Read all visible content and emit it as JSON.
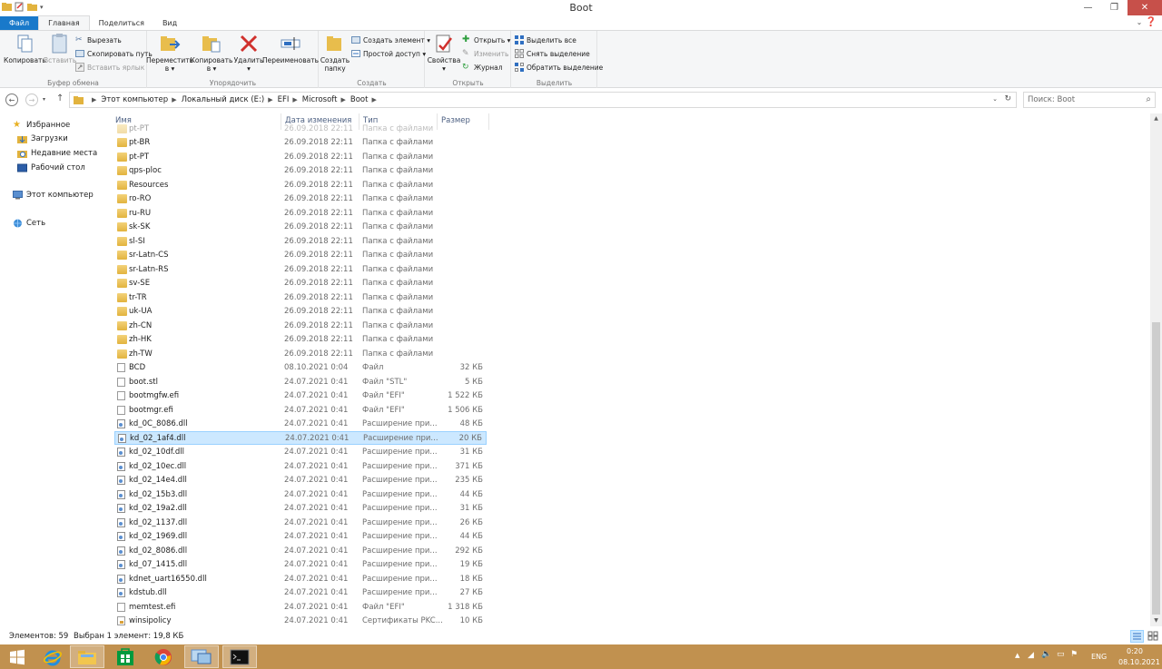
{
  "window": {
    "title": "Boot"
  },
  "tabs": [
    {
      "label": "Файл"
    },
    {
      "label": "Главная"
    },
    {
      "label": "Поделиться"
    },
    {
      "label": "Вид"
    }
  ],
  "ribbon": {
    "clipboard": {
      "label": "Буфер обмена",
      "copy": "Копировать",
      "paste": "Вставить",
      "cut": "Вырезать",
      "copy_path": "Скопировать путь",
      "paste_shortcut": "Вставить ярлык"
    },
    "organize": {
      "label": "Упорядочить",
      "move_to": "Переместить в ▾",
      "copy_to": "Копировать в ▾",
      "delete": "Удалить ▾",
      "rename": "Переименовать"
    },
    "create": {
      "label": "Создать",
      "new_folder": "Создать папку",
      "new_item": "Создать элемент ▾",
      "easy_access": "Простой доступ ▾"
    },
    "open": {
      "label": "Открыть",
      "properties": "Свойства ▾",
      "open": "Открыть ▾",
      "edit": "Изменить",
      "history": "Журнал"
    },
    "select": {
      "label": "Выделить",
      "select_all": "Выделить все",
      "select_none": "Снять выделение",
      "invert": "Обратить выделение"
    }
  },
  "address": {
    "segments": [
      "Этот компьютер",
      "Локальный диск (E:)",
      "EFI",
      "Microsoft",
      "Boot"
    ],
    "search_placeholder": "Поиск: Boot"
  },
  "navpane": {
    "favorites": "Избранное",
    "downloads": "Загрузки",
    "recent": "Недавние места",
    "desktop": "Рабочий стол",
    "this_pc": "Этот компьютер",
    "network": "Сеть"
  },
  "columns": {
    "name": "Имя",
    "date": "Дата изменения",
    "type": "Тип",
    "size": "Размер"
  },
  "files": [
    {
      "name": "pt-PT",
      "date": "26.09.2018 22:11",
      "type": "Папка с файлами",
      "size": "",
      "kind": "folder",
      "partial": true
    },
    {
      "name": "pt-BR",
      "date": "26.09.2018 22:11",
      "type": "Папка с файлами",
      "size": "",
      "kind": "folder"
    },
    {
      "name": "pt-PT",
      "date": "26.09.2018 22:11",
      "type": "Папка с файлами",
      "size": "",
      "kind": "folder"
    },
    {
      "name": "qps-ploc",
      "date": "26.09.2018 22:11",
      "type": "Папка с файлами",
      "size": "",
      "kind": "folder"
    },
    {
      "name": "Resources",
      "date": "26.09.2018 22:11",
      "type": "Папка с файлами",
      "size": "",
      "kind": "folder"
    },
    {
      "name": "ro-RO",
      "date": "26.09.2018 22:11",
      "type": "Папка с файлами",
      "size": "",
      "kind": "folder"
    },
    {
      "name": "ru-RU",
      "date": "26.09.2018 22:11",
      "type": "Папка с файлами",
      "size": "",
      "kind": "folder"
    },
    {
      "name": "sk-SK",
      "date": "26.09.2018 22:11",
      "type": "Папка с файлами",
      "size": "",
      "kind": "folder"
    },
    {
      "name": "sl-SI",
      "date": "26.09.2018 22:11",
      "type": "Папка с файлами",
      "size": "",
      "kind": "folder"
    },
    {
      "name": "sr-Latn-CS",
      "date": "26.09.2018 22:11",
      "type": "Папка с файлами",
      "size": "",
      "kind": "folder"
    },
    {
      "name": "sr-Latn-RS",
      "date": "26.09.2018 22:11",
      "type": "Папка с файлами",
      "size": "",
      "kind": "folder"
    },
    {
      "name": "sv-SE",
      "date": "26.09.2018 22:11",
      "type": "Папка с файлами",
      "size": "",
      "kind": "folder"
    },
    {
      "name": "tr-TR",
      "date": "26.09.2018 22:11",
      "type": "Папка с файлами",
      "size": "",
      "kind": "folder"
    },
    {
      "name": "uk-UA",
      "date": "26.09.2018 22:11",
      "type": "Папка с файлами",
      "size": "",
      "kind": "folder"
    },
    {
      "name": "zh-CN",
      "date": "26.09.2018 22:11",
      "type": "Папка с файлами",
      "size": "",
      "kind": "folder"
    },
    {
      "name": "zh-HK",
      "date": "26.09.2018 22:11",
      "type": "Папка с файлами",
      "size": "",
      "kind": "folder"
    },
    {
      "name": "zh-TW",
      "date": "26.09.2018 22:11",
      "type": "Папка с файлами",
      "size": "",
      "kind": "folder"
    },
    {
      "name": "BCD",
      "date": "08.10.2021 0:04",
      "type": "Файл",
      "size": "32 КБ",
      "kind": "file"
    },
    {
      "name": "boot.stl",
      "date": "24.07.2021 0:41",
      "type": "Файл \"STL\"",
      "size": "5 КБ",
      "kind": "file"
    },
    {
      "name": "bootmgfw.efi",
      "date": "24.07.2021 0:41",
      "type": "Файл \"EFI\"",
      "size": "1 522 КБ",
      "kind": "file"
    },
    {
      "name": "bootmgr.efi",
      "date": "24.07.2021 0:41",
      "type": "Файл \"EFI\"",
      "size": "1 506 КБ",
      "kind": "file"
    },
    {
      "name": "kd_0C_8086.dll",
      "date": "24.07.2021 0:41",
      "type": "Расширение при...",
      "size": "48 КБ",
      "kind": "dll"
    },
    {
      "name": "kd_02_1af4.dll",
      "date": "24.07.2021 0:41",
      "type": "Расширение при...",
      "size": "20 КБ",
      "kind": "dll",
      "selected": true
    },
    {
      "name": "kd_02_10df.dll",
      "date": "24.07.2021 0:41",
      "type": "Расширение при...",
      "size": "31 КБ",
      "kind": "dll"
    },
    {
      "name": "kd_02_10ec.dll",
      "date": "24.07.2021 0:41",
      "type": "Расширение при...",
      "size": "371 КБ",
      "kind": "dll"
    },
    {
      "name": "kd_02_14e4.dll",
      "date": "24.07.2021 0:41",
      "type": "Расширение при...",
      "size": "235 КБ",
      "kind": "dll"
    },
    {
      "name": "kd_02_15b3.dll",
      "date": "24.07.2021 0:41",
      "type": "Расширение при...",
      "size": "44 КБ",
      "kind": "dll"
    },
    {
      "name": "kd_02_19a2.dll",
      "date": "24.07.2021 0:41",
      "type": "Расширение при...",
      "size": "31 КБ",
      "kind": "dll"
    },
    {
      "name": "kd_02_1137.dll",
      "date": "24.07.2021 0:41",
      "type": "Расширение при...",
      "size": "26 КБ",
      "kind": "dll"
    },
    {
      "name": "kd_02_1969.dll",
      "date": "24.07.2021 0:41",
      "type": "Расширение при...",
      "size": "44 КБ",
      "kind": "dll"
    },
    {
      "name": "kd_02_8086.dll",
      "date": "24.07.2021 0:41",
      "type": "Расширение при...",
      "size": "292 КБ",
      "kind": "dll"
    },
    {
      "name": "kd_07_1415.dll",
      "date": "24.07.2021 0:41",
      "type": "Расширение при...",
      "size": "19 КБ",
      "kind": "dll"
    },
    {
      "name": "kdnet_uart16550.dll",
      "date": "24.07.2021 0:41",
      "type": "Расширение при...",
      "size": "18 КБ",
      "kind": "dll"
    },
    {
      "name": "kdstub.dll",
      "date": "24.07.2021 0:41",
      "type": "Расширение при...",
      "size": "27 КБ",
      "kind": "dll"
    },
    {
      "name": "memtest.efi",
      "date": "24.07.2021 0:41",
      "type": "Файл \"EFI\"",
      "size": "1 318 КБ",
      "kind": "file"
    },
    {
      "name": "winsipolicy",
      "date": "24.07.2021 0:41",
      "type": "Сертификаты PKC...",
      "size": "10 КБ",
      "kind": "cert"
    }
  ],
  "status": {
    "items": "Элементов: 59",
    "selected": "Выбран 1 элемент: 19,8 КБ"
  },
  "tray": {
    "lang": "ENG",
    "time": "0:20",
    "date": "08.10.2021"
  },
  "colors": {
    "accent": "#1979ca",
    "taskbar": "#c1914f",
    "selection": "#cce8ff",
    "close": "#c7504a"
  }
}
